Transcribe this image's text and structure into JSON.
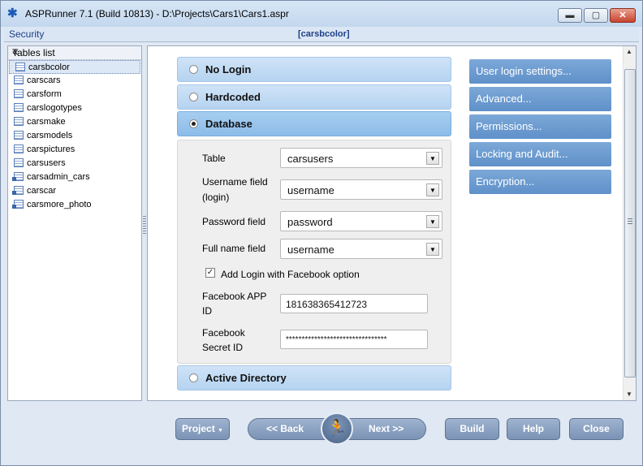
{
  "window": {
    "title": "ASPRunner 7.1 (Build 10813) - D:\\Projects\\Cars1\\Cars1.aspr",
    "controls": {
      "minimize": "▬",
      "maximize": "▢",
      "close": "✕"
    }
  },
  "subbar": {
    "section": "Security",
    "current_table": "[carsbcolor]"
  },
  "tables_list": {
    "header": "Tables list",
    "collapse_glyph": "«",
    "items": [
      {
        "name": "carsbcolor",
        "selected": true,
        "icon": "table-icon"
      },
      {
        "name": "carscars",
        "icon": "table-icon"
      },
      {
        "name": "carsform",
        "icon": "table-icon"
      },
      {
        "name": "carslogotypes",
        "icon": "table-icon"
      },
      {
        "name": "carsmake",
        "icon": "table-icon"
      },
      {
        "name": "carsmodels",
        "icon": "table-icon"
      },
      {
        "name": "carspictures",
        "icon": "table-icon"
      },
      {
        "name": "carsusers",
        "icon": "table-icon"
      },
      {
        "name": "carsadmin_cars",
        "icon": "view-icon"
      },
      {
        "name": "carscar",
        "icon": "view-icon"
      },
      {
        "name": "carsmore_photo",
        "icon": "view-icon"
      }
    ]
  },
  "login_options": {
    "no_login": "No Login",
    "hardcoded": "Hardcoded",
    "database": "Database",
    "active_directory": "Active Directory",
    "selected": "Database"
  },
  "database_settings": {
    "table_label": "Table",
    "table_value": "carsusers",
    "username_label_line1": "Username field",
    "username_label_line2": "(login)",
    "username_value": "username",
    "password_label": "Password field",
    "password_value": "password",
    "fullname_label": "Full name field",
    "fullname_value": "username",
    "facebook_checkbox_label": "Add Login with Facebook option",
    "facebook_checked": true,
    "facebook_app_label_line1": "Facebook APP",
    "facebook_app_label_line2": "ID",
    "facebook_app_value": "181638365412723",
    "facebook_secret_label_line1": "Facebook",
    "facebook_secret_label_line2": "Secret ID",
    "facebook_secret_value": "********************************"
  },
  "side_buttons": [
    "User login settings...",
    "Advanced...",
    "Permissions...",
    "Locking and Audit...",
    "Encryption..."
  ],
  "footer": {
    "project": "Project",
    "back": "<< Back",
    "next": "Next >>",
    "build": "Build",
    "help": "Help",
    "close": "Close"
  },
  "colors": {
    "accent_button": "#6a9bd1",
    "option_bar": "#c2dbf4",
    "option_bar_active": "#97c4ec"
  }
}
